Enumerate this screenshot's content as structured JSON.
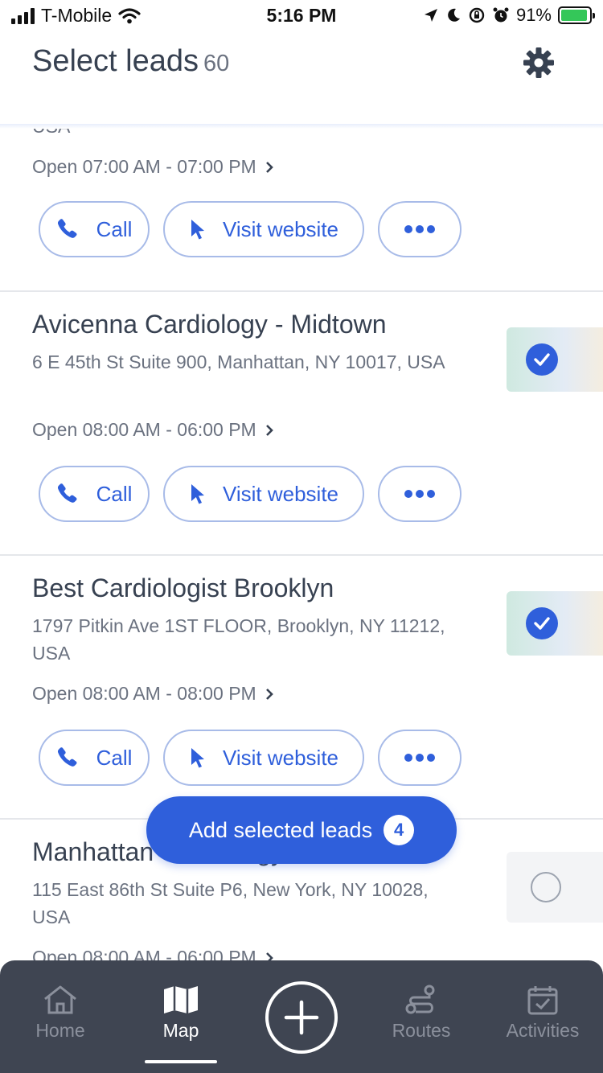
{
  "status_bar": {
    "carrier": "T-Mobile",
    "time": "5:16 PM",
    "battery": "91%"
  },
  "header": {
    "title": "Select leads",
    "count": "60"
  },
  "leads": [
    {
      "address_tail": "USA",
      "hours": "Open 07:00 AM - 07:00 PM",
      "call_label": "Call",
      "website_label": "Visit website",
      "selected": true
    },
    {
      "name": "Avicenna Cardiology - Midtown",
      "address": "6 E 45th St Suite 900, Manhattan, NY 10017, USA",
      "hours": "Open 08:00 AM - 06:00 PM",
      "call_label": "Call",
      "website_label": "Visit website",
      "selected": true
    },
    {
      "name": "Best Cardiologist Brooklyn",
      "address": "1797 Pitkin Ave 1ST FLOOR, Brooklyn, NY 11212, USA",
      "hours": "Open 08:00 AM - 08:00 PM",
      "call_label": "Call",
      "website_label": "Visit website",
      "selected": true
    },
    {
      "name": "Manhattan Cardiology Medical...",
      "address": "115 East 86th St Suite P6, New York, NY 10028, USA",
      "hours": "Open 08:00 AM - 06:00 PM",
      "selected": false
    }
  ],
  "add_selected": {
    "label": "Add selected leads",
    "count": "4"
  },
  "tabs": [
    {
      "label": "Home",
      "icon": "home-icon"
    },
    {
      "label": "Map",
      "icon": "map-icon",
      "active": true
    },
    {
      "label": "",
      "icon": "plus-circle-icon"
    },
    {
      "label": "Routes",
      "icon": "route-icon"
    },
    {
      "label": "Activities",
      "icon": "calendar-check-icon"
    }
  ],
  "colors": {
    "accent": "#2f5fdb",
    "tabbar": "#3f4552",
    "text": "#374151",
    "muted": "#6b7280"
  }
}
